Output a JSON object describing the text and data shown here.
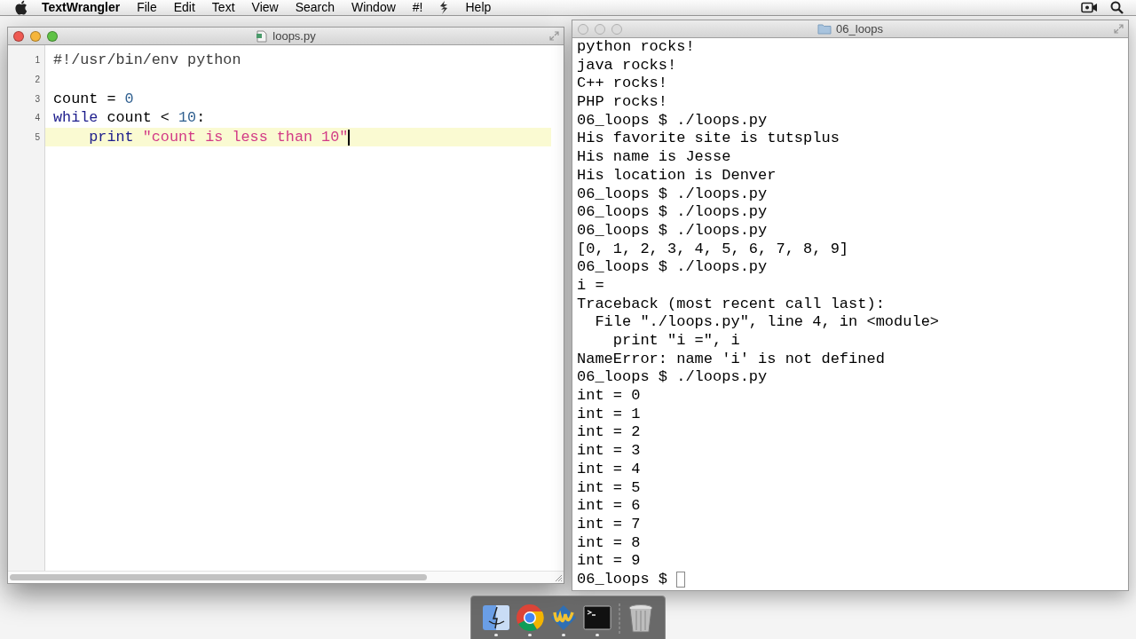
{
  "menu_bar": {
    "app_name": "TextWrangler",
    "items": [
      {
        "kind": "label",
        "text": "File"
      },
      {
        "kind": "label",
        "text": "Edit"
      },
      {
        "kind": "label",
        "text": "Text"
      },
      {
        "kind": "label",
        "text": "View"
      },
      {
        "kind": "label",
        "text": "Search"
      },
      {
        "kind": "label",
        "text": "Window"
      },
      {
        "kind": "label",
        "text": "#!"
      },
      {
        "kind": "script_icon"
      },
      {
        "kind": "label",
        "text": "Help"
      }
    ]
  },
  "editor": {
    "title": "loops.py",
    "active": true,
    "lines": [
      {
        "number": "1",
        "current": false,
        "tokens": [
          {
            "kind": "comment",
            "text": "#!/usr/bin/env python"
          }
        ]
      },
      {
        "number": "2",
        "current": false
      },
      {
        "number": "3",
        "current": false,
        "tokens": [
          {
            "kind": "plain",
            "text": "count = "
          },
          {
            "kind": "number",
            "text": "0"
          }
        ]
      },
      {
        "number": "4",
        "current": false,
        "tokens": [
          {
            "kind": "keyword",
            "text": "while"
          },
          {
            "kind": "plain",
            "text": " count < "
          },
          {
            "kind": "number",
            "text": "10"
          },
          {
            "kind": "plain",
            "text": ":"
          }
        ]
      },
      {
        "number": "5",
        "current": true,
        "tokens": [
          {
            "kind": "keyword",
            "text": "    print"
          },
          {
            "kind": "string",
            "text": " \"count is less than 10\""
          }
        ]
      }
    ]
  },
  "terminal": {
    "title": "06_loops",
    "active": false,
    "lines": [
      "python rocks!",
      "java rocks!",
      "C++ rocks!",
      "PHP rocks!",
      "06_loops $ ./loops.py",
      "His favorite site is tutsplus",
      "His name is Jesse",
      "His location is Denver",
      "06_loops $ ./loops.py",
      "06_loops $ ./loops.py",
      "06_loops $ ./loops.py",
      "[0, 1, 2, 3, 4, 5, 6, 7, 8, 9]",
      "06_loops $ ./loops.py",
      "i =",
      "Traceback (most recent call last):",
      "  File \"./loops.py\", line 4, in <module>",
      "    print \"i =\", i",
      "NameError: name 'i' is not defined",
      "06_loops $ ./loops.py",
      "int = 0",
      "int = 1",
      "int = 2",
      "int = 3",
      "int = 4",
      "int = 5",
      "int = 6",
      "int = 7",
      "int = 8",
      "int = 9"
    ],
    "prompt": "06_loops $"
  },
  "dock": {
    "items": [
      {
        "kind": "finder",
        "running": true
      },
      {
        "kind": "browser",
        "running": true
      },
      {
        "kind": "editor",
        "running": true
      },
      {
        "kind": "terminal",
        "running": true
      },
      {
        "kind": "separator"
      },
      {
        "kind": "trash",
        "running": false
      }
    ]
  }
}
